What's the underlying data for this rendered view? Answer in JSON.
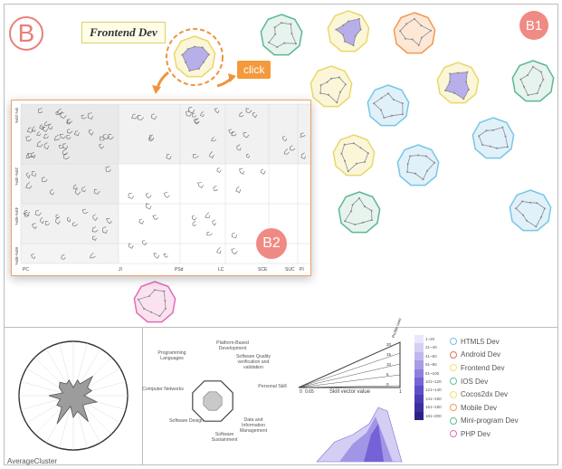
{
  "labels": {
    "main_badge": "B",
    "b1_badge": "B1",
    "b2_badge": "B2",
    "callout": "Frontend Dev",
    "click_button": "click",
    "average_cluster": "AverageCluster"
  },
  "b2_panel": {
    "row_labels": [
      "0%-20%",
      "20%-40%",
      "40%-60%",
      "60%-80%"
    ],
    "col_labels": [
      "PC",
      "JI",
      "PSd",
      "LC",
      "SCE",
      "SUC",
      "PI"
    ]
  },
  "wheel_labels": [
    "Platform-Based Development",
    "Software Quality verification and validation",
    "Personal Skill",
    "Data and Information Management",
    "Software Sustainment",
    "Software Design",
    "Computer Networks",
    "Programming Languages"
  ],
  "triangle": {
    "axis_label": "Skill vector value",
    "tick_left": "0",
    "tick_mid": "0.65",
    "tick_right": "1",
    "side_label": "Profile num",
    "side_ticks": [
      "20",
      "15",
      "10",
      "5",
      "0"
    ]
  },
  "color_scale": {
    "labels": [
      "1~20",
      "21~40",
      "41~60",
      "61~80",
      "81~100",
      "101~120",
      "121~140",
      "141~160",
      "161~180",
      "181~200"
    ],
    "colors": [
      "#e9e5fb",
      "#d5cff6",
      "#c0b7f0",
      "#a79ce8",
      "#8f80e0",
      "#7665d6",
      "#5e4ec8",
      "#4a3cb6",
      "#3a2ea0",
      "#2b2288"
    ]
  },
  "legend": [
    {
      "label": "HTML5 Dev",
      "color": "#6fc3e8"
    },
    {
      "label": "Android Dev",
      "color": "#e56d5a"
    },
    {
      "label": "Frontend Dev",
      "color": "#f2e26b"
    },
    {
      "label": "IOS Dev",
      "color": "#66bfa0"
    },
    {
      "label": "Cocos2dx Dev",
      "color": "#f2e26b"
    },
    {
      "label": "Mobile Dev",
      "color": "#ef9a52"
    },
    {
      "label": "Mini-program Dev",
      "color": "#63b98d"
    },
    {
      "label": "PHP Dev",
      "color": "#e36bb5"
    }
  ],
  "radars": [
    {
      "id": "green-1",
      "stroke": "#5cb794",
      "fill": "#e6f4ed"
    },
    {
      "id": "yellow-1",
      "stroke": "#e9d86a",
      "fill": "#fbf6d8"
    },
    {
      "id": "orange-1",
      "stroke": "#ee9a4e",
      "fill": "#fde8d6"
    },
    {
      "id": "yellow-2",
      "stroke": "#e9d86a",
      "fill": "#fbf6d8"
    },
    {
      "id": "blue-1",
      "stroke": "#78c6e6",
      "fill": "#e0f1f9"
    },
    {
      "id": "yellow-3",
      "stroke": "#e9d86a",
      "fill": "#fbf6d8"
    },
    {
      "id": "green-2",
      "stroke": "#5cb794",
      "fill": "#e6f4ed"
    },
    {
      "id": "blue-2",
      "stroke": "#78c6e6",
      "fill": "#e0f1f9"
    },
    {
      "id": "yellow-4",
      "stroke": "#e9d86a",
      "fill": "#fbf6d8"
    },
    {
      "id": "blue-3",
      "stroke": "#78c6e6",
      "fill": "#e0f1f9"
    },
    {
      "id": "green-3",
      "stroke": "#5cb794",
      "fill": "#e6f4ed"
    },
    {
      "id": "blue-4",
      "stroke": "#78c6e6",
      "fill": "#e0f1f9"
    },
    {
      "id": "pink-1",
      "stroke": "#e36bb5",
      "fill": "#fbe2f0"
    },
    {
      "id": "frontend-selected",
      "stroke": "#e9d86a",
      "fill": "#fbf6d8"
    }
  ]
}
